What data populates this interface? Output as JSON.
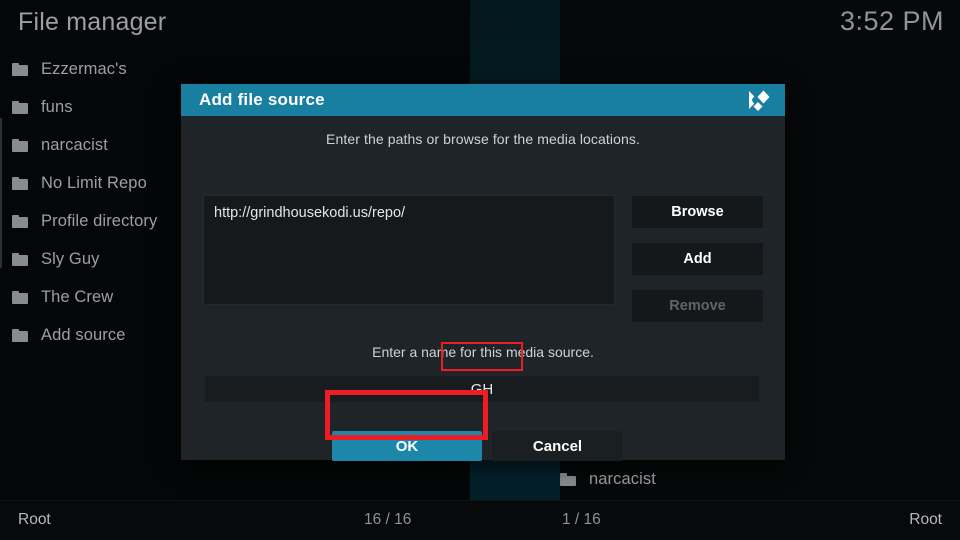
{
  "window": {
    "title": "File manager",
    "clock": "3:52 PM"
  },
  "left_panel": {
    "items": [
      {
        "label": "Ezzermac's",
        "icon": "folder-icon"
      },
      {
        "label": "funs",
        "icon": "folder-icon"
      },
      {
        "label": "narcacist",
        "icon": "folder-icon"
      },
      {
        "label": "No Limit Repo",
        "icon": "folder-icon"
      },
      {
        "label": "Profile directory",
        "icon": "folder-icon"
      },
      {
        "label": "Sly Guy",
        "icon": "folder-icon"
      },
      {
        "label": "The Crew",
        "icon": "folder-icon"
      },
      {
        "label": "Add source",
        "icon": "folder-icon"
      }
    ]
  },
  "right_panel": {
    "items": [
      {
        "label": "narcacist",
        "icon": "folder-icon"
      }
    ]
  },
  "status_bar": {
    "left_path": "Root",
    "left_count": "16 / 16",
    "right_count": "1 / 16",
    "right_path": "Root"
  },
  "dialog": {
    "title": "Add file source",
    "logo": "kodi-logo-icon",
    "hint": "Enter the paths or browse for the media locations.",
    "path_value": "http://grindhousekodi.us/repo/",
    "buttons": {
      "browse": "Browse",
      "add": "Add",
      "remove": "Remove"
    },
    "name_hint": "Enter a name for this media source.",
    "name_value": "GH",
    "ok": "OK",
    "cancel": "Cancel"
  },
  "colors": {
    "accent": "#197fa0",
    "ok_button": "#1c87a8",
    "annotation": "#ee1c25",
    "dialog_bg": "#1e2427",
    "text": "#9aa0a3"
  }
}
